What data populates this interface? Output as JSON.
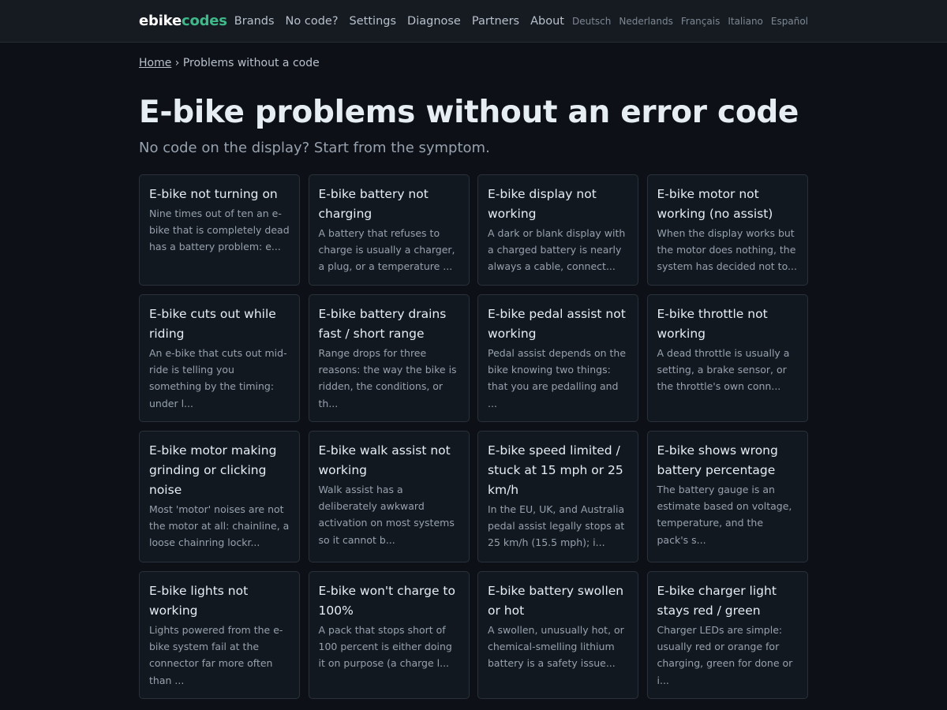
{
  "header": {
    "logo_part1": "ebike",
    "logo_part2": "codes",
    "nav": [
      "Brands",
      "No code?",
      "Settings",
      "Diagnose",
      "Partners",
      "About"
    ],
    "languages": [
      "Deutsch",
      "Nederlands",
      "Français",
      "Italiano",
      "Español"
    ]
  },
  "breadcrumb": {
    "home": "Home",
    "separator": "›",
    "current": "Problems without a code"
  },
  "page": {
    "title": "E-bike problems without an error code",
    "subtitle": "No code on the display? Start from the symptom."
  },
  "cards": [
    {
      "title": "E-bike not turning on",
      "desc": "Nine times out of ten an e-bike that is completely dead has a battery problem: e..."
    },
    {
      "title": "E-bike battery not charging",
      "desc": "A battery that refuses to charge is usually a charger, a plug, or a temperature ..."
    },
    {
      "title": "E-bike display not working",
      "desc": "A dark or blank display with a charged battery is nearly always a cable, connect..."
    },
    {
      "title": "E-bike motor not working (no assist)",
      "desc": "When the display works but the motor does nothing, the system has decided not to..."
    },
    {
      "title": "E-bike cuts out while riding",
      "desc": "An e-bike that cuts out mid-ride is telling you something by the timing: under l..."
    },
    {
      "title": "E-bike battery drains fast / short range",
      "desc": "Range drops for three reasons: the way the bike is ridden, the conditions, or th..."
    },
    {
      "title": "E-bike pedal assist not working",
      "desc": "Pedal assist depends on the bike knowing two things: that you are pedalling and ..."
    },
    {
      "title": "E-bike throttle not working",
      "desc": "A dead throttle is usually a setting, a brake sensor, or the throttle's own conn..."
    },
    {
      "title": "E-bike motor making grinding or clicking noise",
      "desc": "Most 'motor' noises are not the motor at all: chainline, a loose chainring lockr..."
    },
    {
      "title": "E-bike walk assist not working",
      "desc": "Walk assist has a deliberately awkward activation on most systems so it cannot b..."
    },
    {
      "title": "E-bike speed limited / stuck at 15 mph or 25 km/h",
      "desc": "In the EU, UK, and Australia pedal assist legally stops at 25 km/h (15.5 mph); i..."
    },
    {
      "title": "E-bike shows wrong battery percentage",
      "desc": "The battery gauge is an estimate based on voltage, temperature, and the pack's s..."
    },
    {
      "title": "E-bike lights not working",
      "desc": "Lights powered from the e-bike system fail at the connector far more often than ..."
    },
    {
      "title": "E-bike won't charge to 100%",
      "desc": "A pack that stops short of 100 percent is either doing it on purpose (a charge l..."
    },
    {
      "title": "E-bike battery swollen or hot",
      "desc": "A swollen, unusually hot, or chemical-smelling lithium battery is a safety issue..."
    },
    {
      "title": "E-bike charger light stays red / green",
      "desc": "Charger LEDs are simple: usually red or orange for charging, green for done or i..."
    }
  ],
  "colors": {
    "background": "#0d1117",
    "header_bg": "#161b22",
    "card_bg": "#121820",
    "accent": "#3fb98a"
  }
}
